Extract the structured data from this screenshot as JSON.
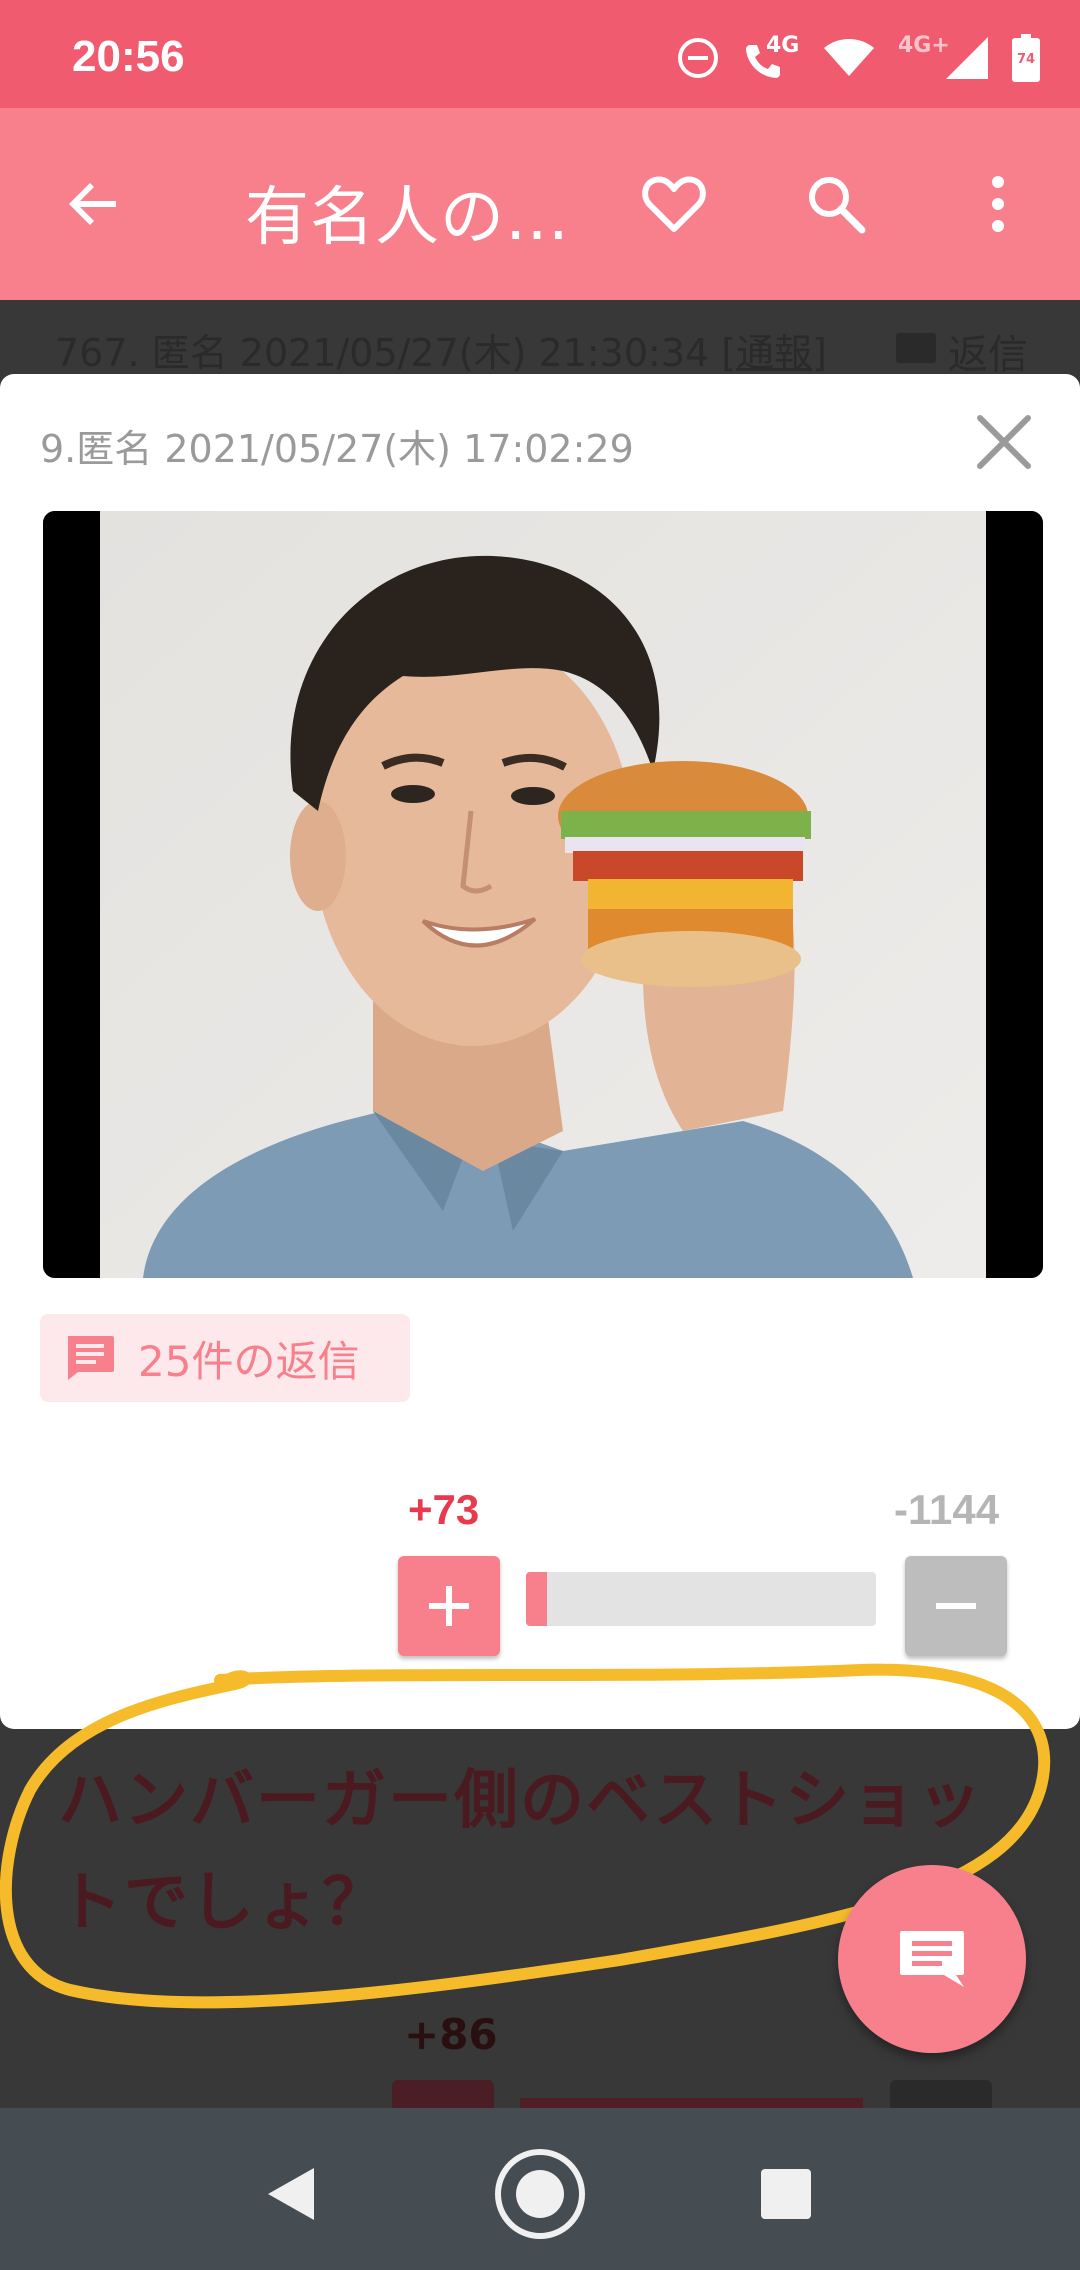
{
  "status_bar": {
    "time": "20:56",
    "network_label": "4G",
    "network_label_2": "4G+",
    "battery": "74"
  },
  "app_bar": {
    "title": "有名人の…",
    "icons": [
      "back-arrow-icon",
      "heart-icon",
      "search-icon",
      "more-vert-icon"
    ]
  },
  "background_post": {
    "header_number": "767. 匿名 2021/05/27(木) 21:30:34 ",
    "header_report": "[通報]",
    "reply_label": "返信",
    "text": "ハンバーガー側のベストショットでしょ？",
    "vote_plus": "+86"
  },
  "modal": {
    "meta": "9.匿名 2021/05/27(木) 17:02:29",
    "reply_chip": "25件の返信",
    "vote_plus": "+73",
    "vote_minus": "-1144",
    "vote_ratio": 0.06
  },
  "colors": {
    "status_bar": "#f15b6f",
    "app_bar": "#f7808c",
    "accent": "#f7808c",
    "plus_text": "#e8394d",
    "annotation": "#f6bb2a"
  }
}
